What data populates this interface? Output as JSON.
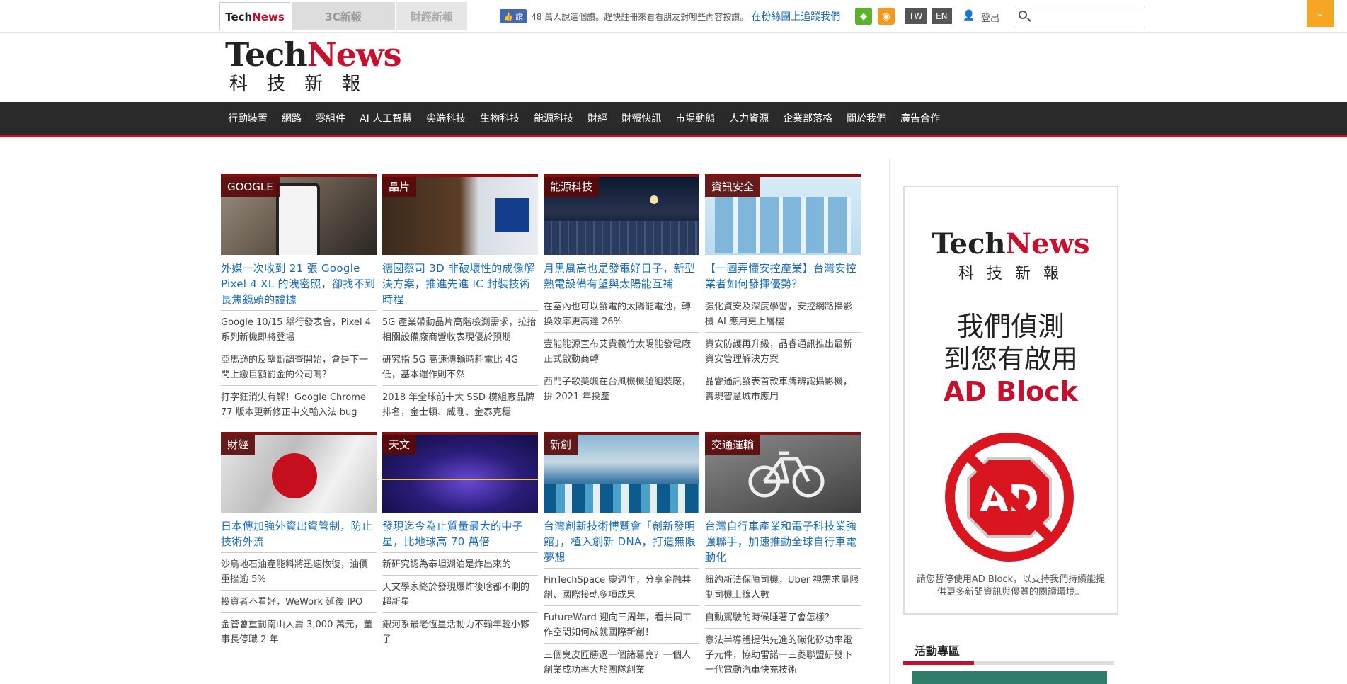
{
  "topbar": {
    "tabs": [
      {
        "tk": "Tech",
        "nw": "News"
      },
      {
        "label": "3C新報"
      },
      {
        "label": "財經新報"
      }
    ],
    "like_button": "讚",
    "like_text": "48 萬人說這個讚。趕快註冊來看看朋友對哪些內容按讚。",
    "fan_link": "在粉絲團上追蹤我們",
    "lang": [
      "TW",
      "EN"
    ],
    "logout": "登出",
    "search_placeholder": ""
  },
  "logo": {
    "tk": "Tech",
    "nw": "News",
    "cn": "科技新報"
  },
  "nav": [
    "行動裝置",
    "網路",
    "零組件",
    "AI 人工智慧",
    "尖端科技",
    "生物科技",
    "能源科技",
    "財經",
    "財報快訊",
    "市場動態",
    "人力資源",
    "企業部落格",
    "關於我們",
    "廣告合作"
  ],
  "articles": [
    {
      "cat": "GOOGLE",
      "headline": "外媒一次收到 21 張 Google Pixel 4 XL 的洩密照，卻找不到長焦鏡頭的證據",
      "subs": [
        "Google 10/15 舉行發表會，Pixel 4 系列新機即將登場",
        "亞馬遜的反壟斷調查開始，會是下一間上繳巨額罰金的公司嗎？",
        "打字狂消失有解！Google Chrome 77 版本更新修正中文輸入法 bug"
      ]
    },
    {
      "cat": "晶片",
      "headline": "德國蔡司 3D 非破壞性的成像解決方案，推進先進 IC 封裝技術時程",
      "subs": [
        "5G 產業帶動晶片高階檢測需求，拉抬相關設備廠商營收表現優於預期",
        "研究指 5G 高速傳輸時耗電比 4G 低，基本運作則不然",
        "2018 年全球前十大 SSD 模組廠品牌排名，金士頓、威剛、金泰克穩"
      ]
    },
    {
      "cat": "能源科技",
      "headline": "月黑風高也是發電好日子，新型熱電設備有望與太陽能互補",
      "subs": [
        "在室內也可以發電的太陽能電池，轉換效率更高達 26%",
        "壹能能源宣布艾貴義竹太陽能發電廠正式啟動商轉",
        "西門子歌美颯在台風機機艙組裝廠，拚 2021 年投產"
      ]
    },
    {
      "cat": "資訊安全",
      "headline": "【一圖弄懂安控產業】台灣安控業者如何發揮優勢？",
      "subs": [
        "強化資安及深度學習，安控網路攝影機 AI 應用更上層樓",
        "資安防護再升級，晶睿通訊推出最新資安管理解決方案",
        "晶睿通訊發表首款車牌辨識攝影機，實現智慧城市應用"
      ]
    },
    {
      "cat": "財經",
      "headline": "日本傳加強外資出資管制，防止技術外流",
      "subs": [
        "沙烏地石油產能料將迅速恢復，油價重挫逾 5%",
        "投資者不看好，WeWork 延後 IPO",
        "金管會重罰南山人壽 3,000 萬元，董事長停職 2 年"
      ]
    },
    {
      "cat": "天文",
      "headline": "發現迄今為止質量最大的中子星，比地球高 70 萬倍",
      "subs": [
        "新研究認為泰坦湖泊是炸出來的",
        "天文學家終於發現爆炸後啥都不剩的超新星",
        "銀河系最老恆星活動力不輸年輕小夥子"
      ]
    },
    {
      "cat": "新創",
      "headline": "台灣創新技術博覽會「創新發明館」，植入創新 DNA，打造無限夢想",
      "subs": [
        "FinTechSpace 慶週年，分享金融共創、國際接軌多項成果",
        "FutureWard 迎向三周年，看共同工作空間如何成就國際新創！",
        "三個臭皮匠勝過一個諸葛亮？一個人創業成功率大於團隊創業"
      ]
    },
    {
      "cat": "交通運輸",
      "headline": "台灣自行車產業和電子科技業強強聯手，加速推動全球自行車電動化",
      "subs": [
        "紐約新法保障司機，Uber 視需求量限制司機上線人數",
        "自動駕駛的時候睡著了會怎樣？",
        "意法半導體提供先進的碳化矽功率電子元件，協助雷諾一三菱聯盟研發下一代電動汽車快充技術"
      ]
    }
  ],
  "sidebar": {
    "logo_tk": "Tech",
    "logo_nw": "News",
    "logo_cn": "科技新報",
    "ad_line1": "我們偵測",
    "ad_line2": "到您有啟用",
    "ad_line3": "AD Block",
    "ad_icon_text": "AD",
    "ad_note": "請您暫停使用AD Block，以支持我們持續能提供更多新聞資訊與優質的閱讀環境。",
    "events_title": "活動專區"
  }
}
